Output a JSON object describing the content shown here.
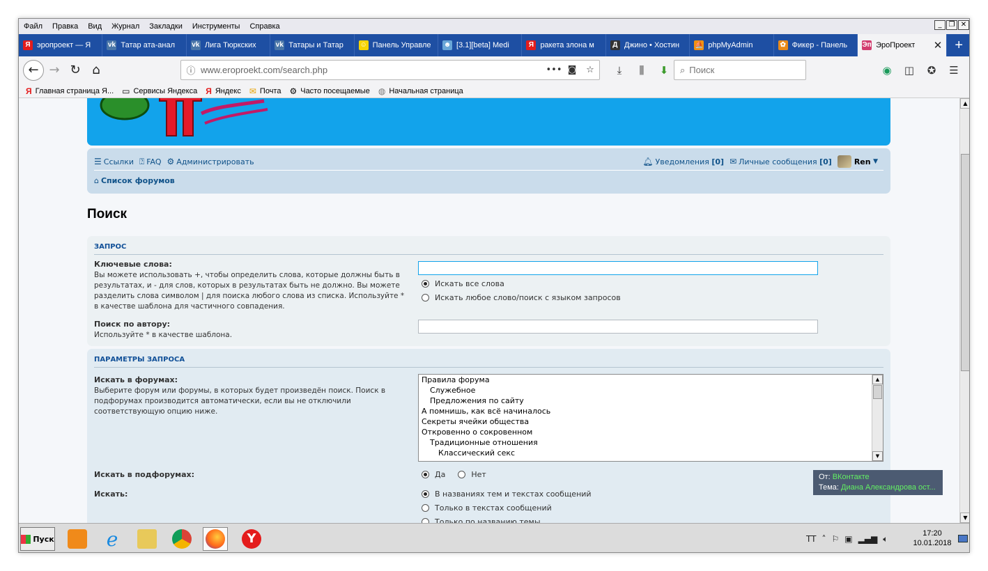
{
  "menubar": {
    "items": [
      "Файл",
      "Правка",
      "Вид",
      "Журнал",
      "Закладки",
      "Инструменты",
      "Справка"
    ]
  },
  "window_controls": [
    "_",
    "❐",
    "✕"
  ],
  "tabs": [
    {
      "title": "эропроект — Я",
      "icon": "Я",
      "color": "#e41c1c"
    },
    {
      "title": "Татар ата-анал",
      "icon": "vk",
      "color": "#4a76a8"
    },
    {
      "title": "Лига Тюркских",
      "icon": "vk",
      "color": "#4a76a8"
    },
    {
      "title": "Татары и Татар",
      "icon": "vk",
      "color": "#4a76a8"
    },
    {
      "title": "Панель Управле",
      "icon": "☺",
      "color": "#f6d400"
    },
    {
      "title": "[3.1][beta] Medi",
      "icon": "☻",
      "color": "#6aa7d8"
    },
    {
      "title": "ракета злона м",
      "icon": "Я",
      "color": "#e41c1c"
    },
    {
      "title": "Джино • Хостин",
      "icon": "Д",
      "color": "#333333"
    },
    {
      "title": "phpMyAdmin",
      "icon": "⛵",
      "color": "#f29111"
    },
    {
      "title": "Фикер - Панель",
      "icon": "✿",
      "color": "#e98b1a"
    },
    {
      "title": "ЭроПроект",
      "icon": "Эп",
      "color": "#d23b6e",
      "active": true
    }
  ],
  "navbar": {
    "url": "www.eroproekt.com/search.php",
    "search_placeholder": "Поиск"
  },
  "bookmarks": [
    {
      "label": "Главная страница Я...",
      "icon": "Я"
    },
    {
      "label": "Сервисы Яндекса",
      "icon": "▭"
    },
    {
      "label": "Яндекс",
      "icon": "Я"
    },
    {
      "label": "Почта",
      "icon": "✉"
    },
    {
      "label": "Часто посещаемые",
      "icon": "⚙"
    },
    {
      "label": "Начальная страница",
      "icon": "◍"
    }
  ],
  "forum_nav": {
    "links_label": "Ссылки",
    "faq_label": "FAQ",
    "admin_label": "Администрировать",
    "notifications_label": "Уведомления",
    "notifications_count": "[0]",
    "messages_label": "Личные сообщения",
    "messages_count": "[0]",
    "username": "Ren",
    "breadcrumb": "Список форумов"
  },
  "page": {
    "title": "Поиск"
  },
  "query_panel": {
    "title": "ЗАПРОС",
    "keywords_label": "Ключевые слова:",
    "keywords_desc": "Вы можете использовать +, чтобы определить слова, которые должны быть в результатах, и - для слов, которых в результатах быть не должно. Вы можете разделить слова символом | для поиска любого слова из списка. Используйте * в качестве шаблона для частичного совпадения.",
    "radio_all": "Искать все слова",
    "radio_any": "Искать любое слово/поиск с языком запросов",
    "author_label": "Поиск по автору:",
    "author_desc": "Используйте * в качестве шаблона."
  },
  "params_panel": {
    "title": "ПАРАМЕТРЫ ЗАПРОСА",
    "forums_label": "Искать в форумах:",
    "forums_desc": "Выберите форум или форумы, в которых будет произведён поиск. Поиск в подфорумах производится автоматически, если вы не отключили соответствующую опцию ниже.",
    "forums": [
      {
        "name": "Правила форума",
        "indent": 0
      },
      {
        "name": "Служебное",
        "indent": 1
      },
      {
        "name": "Предложения по сайту",
        "indent": 1
      },
      {
        "name": "А помнишь, как всё начиналось",
        "indent": 0
      },
      {
        "name": "Секреты ячейки общества",
        "indent": 0
      },
      {
        "name": "Откровенно о сокровенном",
        "indent": 0
      },
      {
        "name": "Традиционные отношения",
        "indent": 1
      },
      {
        "name": "Классический секс",
        "indent": 2
      }
    ],
    "subforums_label": "Искать в подфорумах:",
    "yes": "Да",
    "no": "Нет",
    "search_in_label": "Искать:",
    "search_in_titles_texts": "В названиях тем и текстах сообщений",
    "search_in_texts": "Только в текстах сообщений",
    "search_in_titles": "Только по названию темы"
  },
  "notification": {
    "from_label": "От:",
    "from_value": "ВКонтакте",
    "subject_label": "Тема:",
    "subject_value": "Диана Александрова ост..."
  },
  "taskbar": {
    "start_label": "Пуск",
    "lang": "TT",
    "time": "17:20",
    "date": "10.01.2018"
  }
}
